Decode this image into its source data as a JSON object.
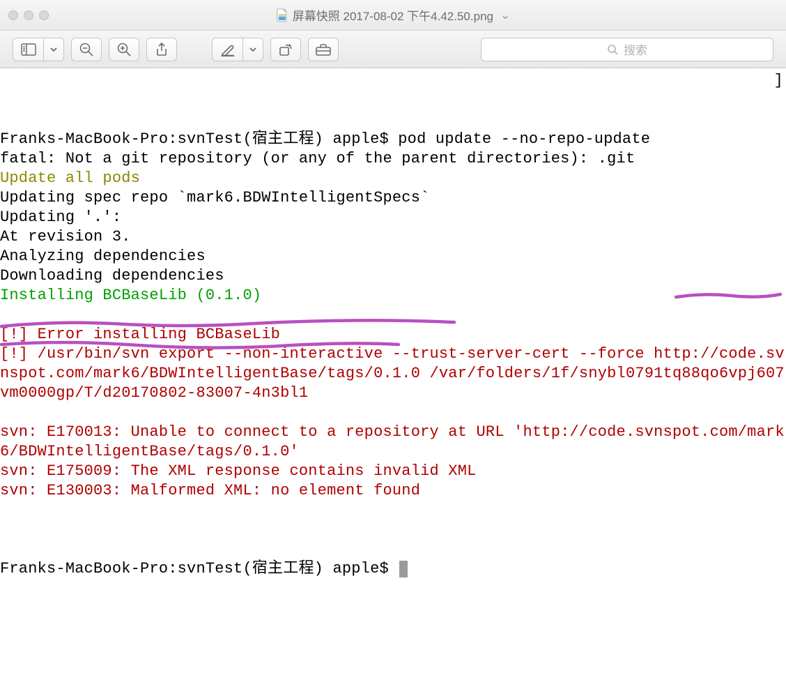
{
  "window": {
    "title": "屏幕快照 2017-08-02 下午4.42.50.png",
    "dropdown_arrow": "⌄"
  },
  "toolbar": {
    "search_placeholder": "搜索"
  },
  "terminal": {
    "lines": [
      {
        "cls": "c-black",
        "text": "Franks-MacBook-Pro:svnTest(宿主工程) apple$ pod update --no-repo-update"
      },
      {
        "cls": "c-black",
        "text": "fatal: Not a git repository (or any of the parent directories): .git"
      },
      {
        "cls": "c-olive",
        "text": "Update all pods"
      },
      {
        "cls": "c-black",
        "text": "Updating spec repo `mark6.BDWIntelligentSpecs`"
      },
      {
        "cls": "c-black",
        "text": "Updating '.':"
      },
      {
        "cls": "c-black",
        "text": "At revision 3."
      },
      {
        "cls": "c-black",
        "text": "Analyzing dependencies"
      },
      {
        "cls": "c-black",
        "text": "Downloading dependencies"
      },
      {
        "cls": "c-green",
        "text": "Installing BCBaseLib (0.1.0)"
      },
      {
        "cls": "c-black",
        "text": ""
      },
      {
        "cls": "c-red",
        "text": "[!] Error installing BCBaseLib"
      },
      {
        "cls": "c-red",
        "text": "[!] /usr/bin/svn export --non-interactive --trust-server-cert --force http://code.svnspot.com/mark6/BDWIntelligentBase/tags/0.1.0 /var/folders/1f/snybl0791tq88qo6vpj607vm0000gp/T/d20170802-83007-4n3bl1"
      },
      {
        "cls": "c-black",
        "text": ""
      },
      {
        "cls": "c-red",
        "text": "svn: E170013: Unable to connect to a repository at URL 'http://code.svnspot.com/mark6/BDWIntelligentBase/tags/0.1.0'"
      },
      {
        "cls": "c-red",
        "text": "svn: E175009: The XML response contains invalid XML"
      },
      {
        "cls": "c-red",
        "text": "svn: E130003: Malformed XML: no element found"
      },
      {
        "cls": "c-black",
        "text": ""
      }
    ],
    "prompt": "Franks-MacBook-Pro:svnTest(宿主工程) apple$ ",
    "right_bracket": "]"
  }
}
